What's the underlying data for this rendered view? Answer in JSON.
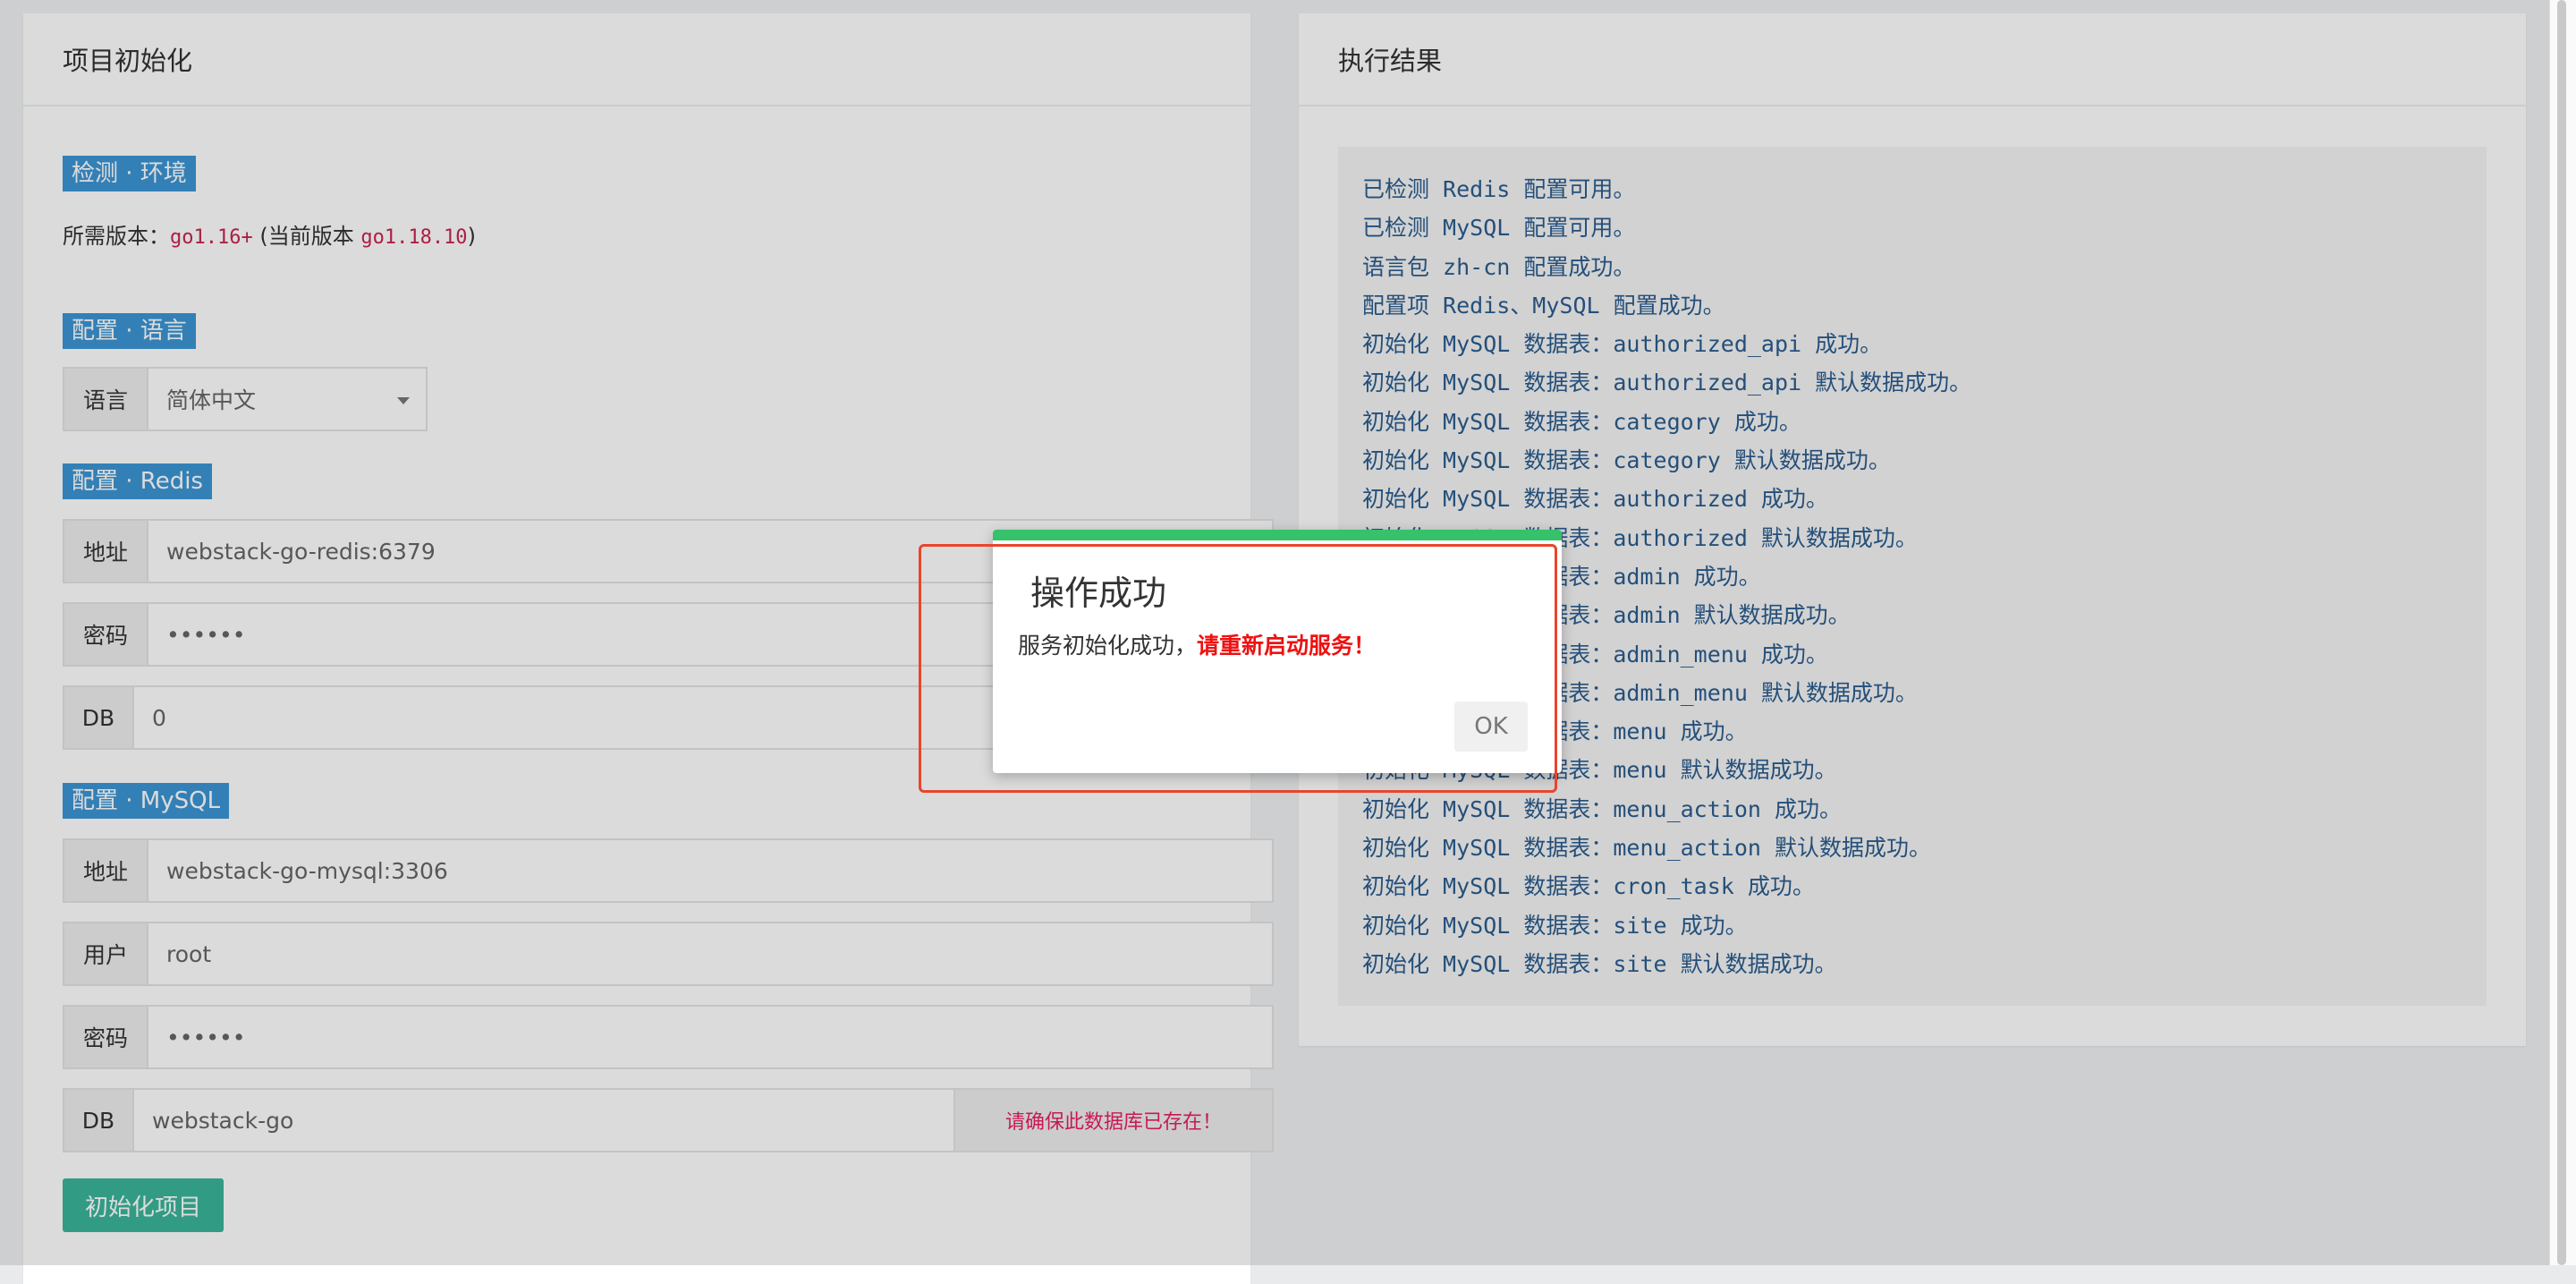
{
  "left_panel": {
    "title": "项目初始化",
    "env": {
      "tag": "检测 · 环境",
      "required_label": "所需版本：",
      "required_version": "go1.16+",
      "current_open": " (当前版本 ",
      "current_version": "go1.18.10",
      "current_close": ")"
    },
    "language": {
      "tag": "配置 · 语言",
      "label": "语言",
      "value": "简体中文"
    },
    "redis": {
      "tag": "配置 · Redis",
      "address_label": "地址",
      "address_value": "webstack-go-redis:6379",
      "password_label": "密码",
      "password_value": "••••••",
      "db_label": "DB",
      "db_value": "0"
    },
    "mysql": {
      "tag": "配置 · MySQL",
      "address_label": "地址",
      "address_value": "webstack-go-mysql:3306",
      "user_label": "用户",
      "user_value": "root",
      "password_label": "密码",
      "password_value": "••••••",
      "db_label": "DB",
      "db_value": "webstack-go",
      "db_hint": "请确保此数据库已存在！"
    },
    "init_button": "初始化项目"
  },
  "right_panel": {
    "title": "执行结果",
    "log": [
      "已检测 Redis 配置可用。",
      "已检测 MySQL 配置可用。",
      "语言包 zh-cn 配置成功。",
      "配置项 Redis、MySQL 配置成功。",
      "初始化 MySQL 数据表：authorized_api 成功。",
      "初始化 MySQL 数据表：authorized_api 默认数据成功。",
      "初始化 MySQL 数据表：category 成功。",
      "初始化 MySQL 数据表：category 默认数据成功。",
      "初始化 MySQL 数据表：authorized 成功。",
      "初始化 MySQL 数据表：authorized 默认数据成功。",
      "初始化 MySQL 数据表：admin 成功。",
      "初始化 MySQL 数据表：admin 默认数据成功。",
      "初始化 MySQL 数据表：admin_menu 成功。",
      "初始化 MySQL 数据表：admin_menu 默认数据成功。",
      "初始化 MySQL 数据表：menu 成功。",
      "初始化 MySQL 数据表：menu 默认数据成功。",
      "初始化 MySQL 数据表：menu_action 成功。",
      "初始化 MySQL 数据表：menu_action 默认数据成功。",
      "初始化 MySQL 数据表：cron_task 成功。",
      "初始化 MySQL 数据表：site 成功。",
      "初始化 MySQL 数据表：site 默认数据成功。"
    ]
  },
  "modal": {
    "title": "操作成功",
    "message": "服务初始化成功，",
    "warning": "请重新启动服务！",
    "ok": "OK"
  },
  "colors": {
    "tag_blue": "#3c96d6",
    "button_green": "#3bb59a",
    "modal_accent": "#35c26a",
    "warning_red": "#ee1111",
    "highlight_red": "#e8452c",
    "log_text": "#2a5d8e"
  }
}
